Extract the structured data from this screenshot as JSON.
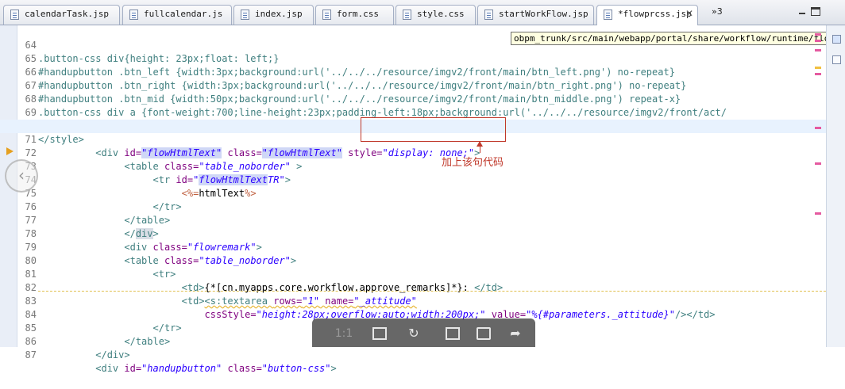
{
  "tabs": [
    {
      "label": "calendarTask.jsp"
    },
    {
      "label": "fullcalendar.js"
    },
    {
      "label": "index.jsp"
    },
    {
      "label": "form.css"
    },
    {
      "label": "style.css"
    },
    {
      "label": "startWorkFlow.jsp"
    },
    {
      "label": "*flowprcss.jsp",
      "close": "✕"
    }
  ],
  "tab_overflow": "»3",
  "tooltip": "obpm_trunk/src/main/webapp/portal/share/workflow/runtime/flowprcss.jsp",
  "lines": {
    "l64": {
      "num": "64",
      "text": ".button-css div{height: 23px;float: left;}"
    },
    "l65": {
      "num": "65",
      "text": "#handupbutton .btn_left {width:3px;background:url('../../../resource/imgv2/front/main/btn_left.png') no-repeat}"
    },
    "l66": {
      "num": "66",
      "text": "#handupbutton .btn_right {width:3px;background:url('../../../resource/imgv2/front/main/btn_right.png') no-repeat}"
    },
    "l67": {
      "num": "67",
      "text": "#handupbutton .btn_mid {width:50px;background:url('../../../resource/imgv2/front/main/btn_middle.png') repeat-x}"
    },
    "l68": {
      "num": "68",
      "text": ".button-css div a {font-weight:700;line-height:23px;padding-left:18px;background:url('../../../resource/imgv2/front/act/"
    },
    "l69": {
      "num": "69",
      "text": ""
    },
    "l70": {
      "num": "70",
      "text": "</style>"
    },
    "l71": {
      "num": "71",
      "indent": "          ",
      "open": "<div ",
      "attr1": "id=",
      "val1": "\"flowHtmlText\"",
      "attr2": " class=",
      "val2": "\"flowHtmlText\"",
      "attr3": " style=",
      "val3a": "\"",
      "val3b": "display: none;",
      "val3c": "\"",
      "close": ">"
    },
    "l72": {
      "num": "72",
      "indent": "               ",
      "open": "<table ",
      "attr1": "class=",
      "val1": "\"table_noborder\"",
      "close": " >"
    },
    "l73": {
      "num": "73",
      "indent": "                    ",
      "open": "<tr ",
      "attr1": "id=",
      "val1a": "\"",
      "val1hl": "flowHtmlText",
      "val1b": "TR\"",
      "close": ">"
    },
    "l74": {
      "num": "74",
      "indent": "                         ",
      "jsp_open": "<%=",
      "expr": "htmlText",
      "jsp_close": "%>"
    },
    "l75": {
      "num": "75",
      "indent": "                    ",
      "text": "</tr>"
    },
    "l76": {
      "num": "76",
      "indent": "               ",
      "text": "</table>"
    },
    "l77": {
      "num": "77",
      "indent": "               ",
      "pre": "</",
      "hl": "div",
      "post": ">"
    },
    "l78": {
      "num": "78",
      "indent": "               ",
      "open": "<div ",
      "attr1": "class=",
      "val1": "\"flowremark\"",
      "close": ">"
    },
    "l79": {
      "num": "79",
      "indent": "               ",
      "open": "<table ",
      "attr1": "class=",
      "val1": "\"table_noborder\"",
      "close": ">"
    },
    "l80": {
      "num": "80",
      "indent": "                    ",
      "text": "<tr>"
    },
    "l81": {
      "num": "81",
      "indent": "                         ",
      "open": "<td>",
      "body": "{*[cn.myapps.core.workflow.approve_remarks]*}: ",
      "close": "</td>"
    },
    "l82": {
      "num": "82",
      "indent": "                         ",
      "open": "<td>",
      "open2": "<s:textarea ",
      "attr1": "rows=",
      "val1": "\"1\"",
      "attr2": " name=",
      "val2": "\"_attitude\""
    },
    "l83": {
      "num": "83",
      "indent": "                             ",
      "attr1": "cssStyle=",
      "val1": "\"height:28px;overflow:auto;width:200px;\"",
      "attr2": " value=",
      "val2": "\"%{#parameters._attitude}\"",
      "close": "/></td>"
    },
    "l84": {
      "num": "84",
      "indent": "                    ",
      "text": "</tr>"
    },
    "l85": {
      "num": "85",
      "indent": "               ",
      "text": "</table>"
    },
    "l86": {
      "num": "86",
      "indent": "          ",
      "text": "</div>"
    },
    "l87": {
      "num": "87",
      "indent": "          ",
      "open": "<div ",
      "attr1": "id=",
      "val1": "\"handupbutton\"",
      "attr2": " class=",
      "val2": "\"button-css\"",
      "close": ">"
    }
  },
  "annotation": {
    "text": "加上该句代码"
  },
  "viewer": {
    "ratio_label": "1:1"
  },
  "colors": {
    "annotation": "#c0392b",
    "tag": "#3f7f7f",
    "attribute": "#7f007f",
    "string": "#2a00ff"
  }
}
